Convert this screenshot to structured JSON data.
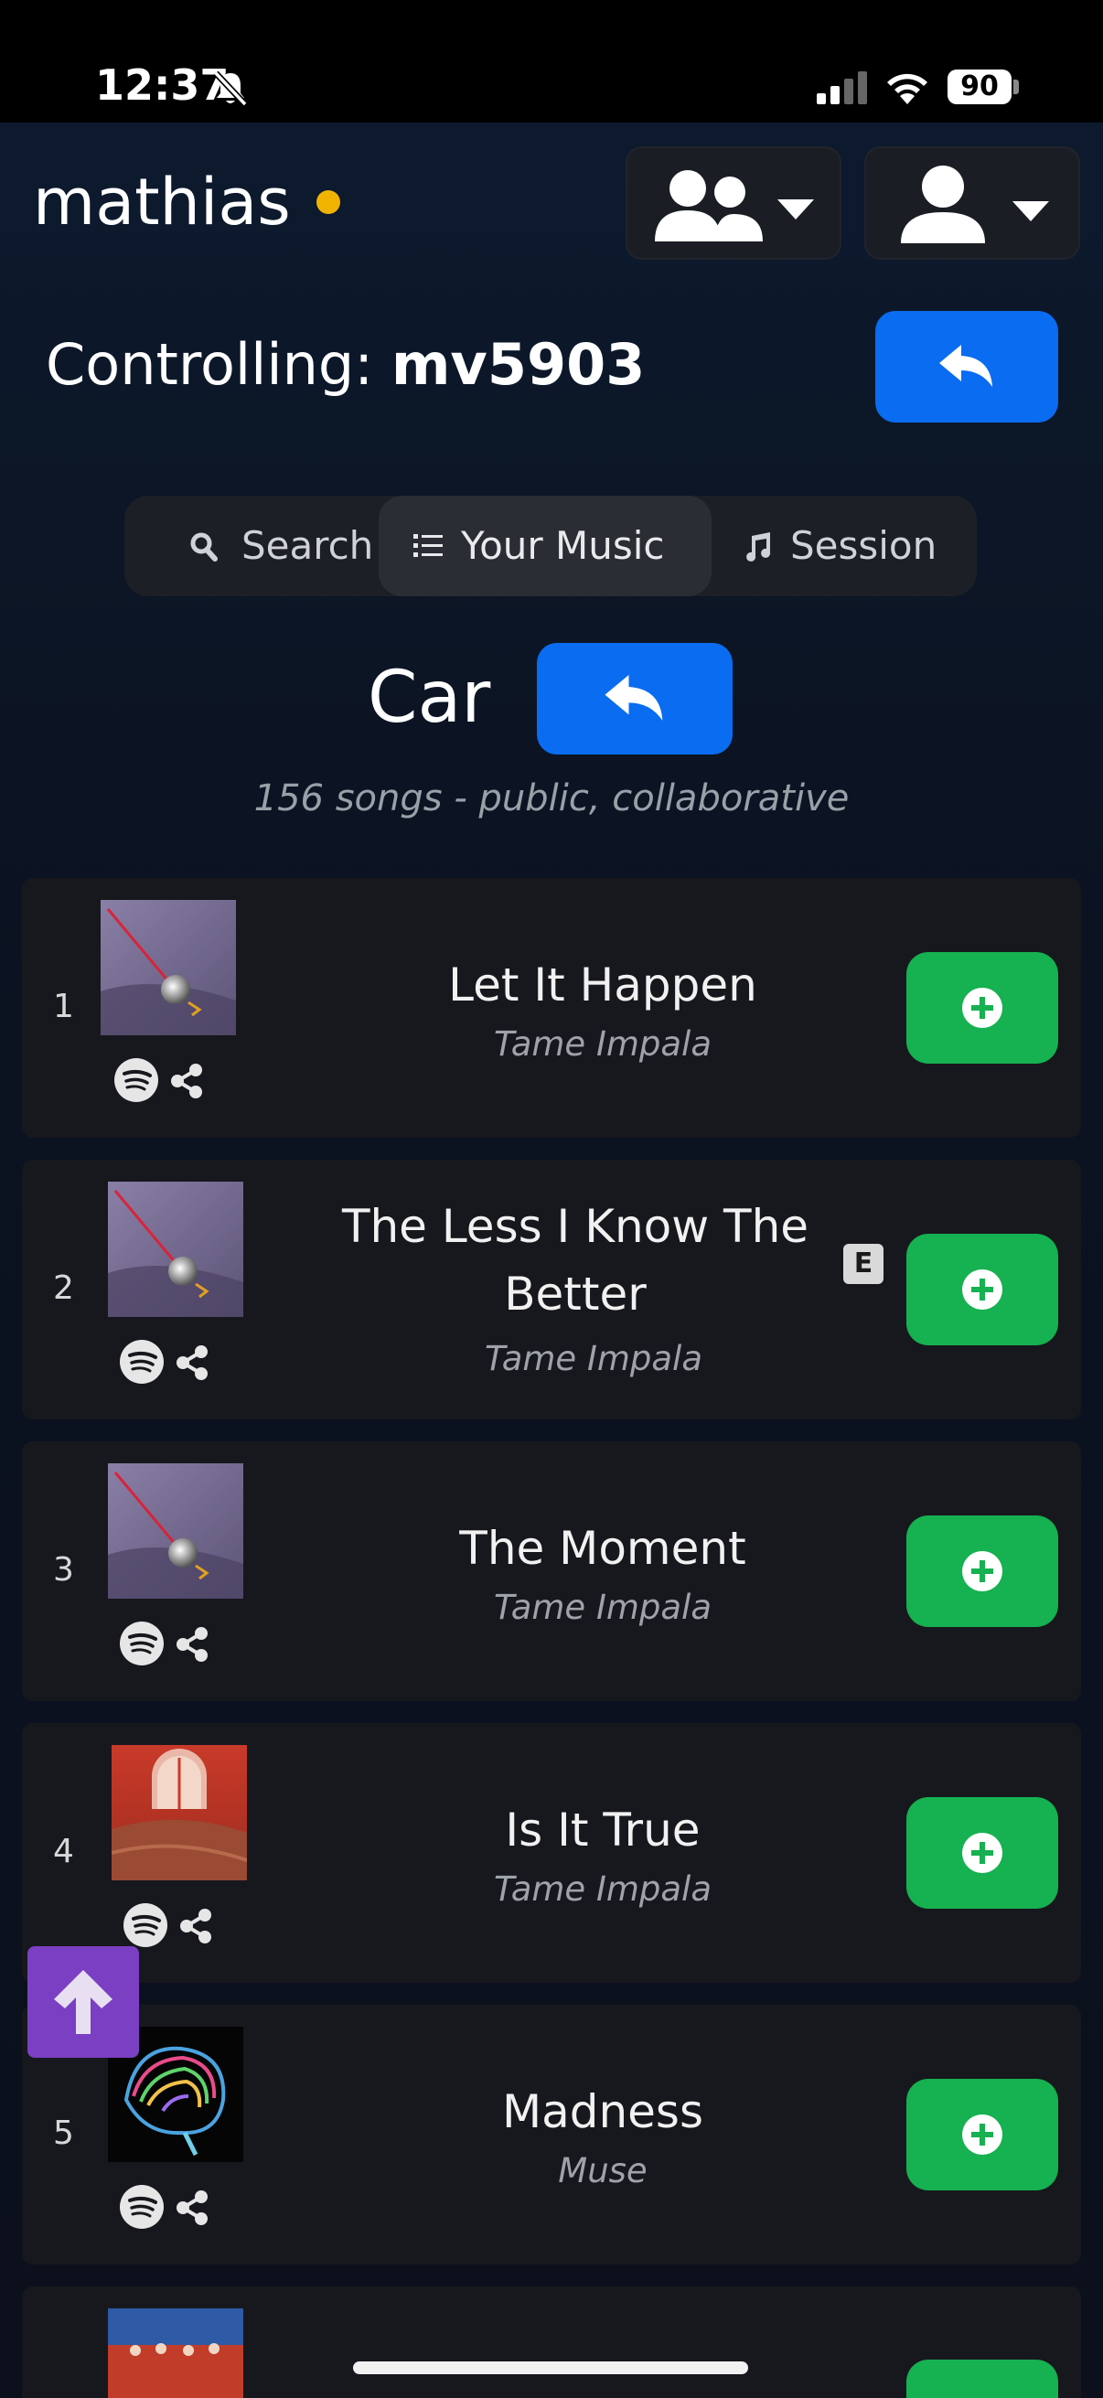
{
  "status_bar": {
    "time": "12:37",
    "battery": "90"
  },
  "header": {
    "username": "mathias",
    "controlling_prefix": "Controlling: ",
    "controlling_target": "mv5903"
  },
  "tabs": [
    {
      "label": "Search",
      "icon": "search-icon",
      "active": false
    },
    {
      "label": "Your Music",
      "icon": "list-icon",
      "active": true
    },
    {
      "label": "Session",
      "icon": "music-note-icon",
      "active": false
    }
  ],
  "playlist": {
    "name": "Car",
    "meta": "156 songs - public, collaborative"
  },
  "tracks": [
    {
      "index": "1",
      "title_lines": [
        "Let It Happen"
      ],
      "artist": "Tame Impala",
      "explicit": false
    },
    {
      "index": "2",
      "title_lines": [
        "The Less I Know The",
        "Better"
      ],
      "artist": "Tame Impala",
      "explicit": true,
      "explicit_label": "E"
    },
    {
      "index": "3",
      "title_lines": [
        "The Moment"
      ],
      "artist": "Tame Impala",
      "explicit": false
    },
    {
      "index": "4",
      "title_lines": [
        "Is It True"
      ],
      "artist": "Tame Impala",
      "explicit": false
    },
    {
      "index": "5",
      "title_lines": [
        "Madness"
      ],
      "artist": "Muse",
      "explicit": false
    }
  ],
  "colors": {
    "accent_blue": "#0a6cf0",
    "add_green": "#16b150",
    "scroll_top_purple": "#7b3fc4",
    "status_dot": "#f0b400"
  }
}
